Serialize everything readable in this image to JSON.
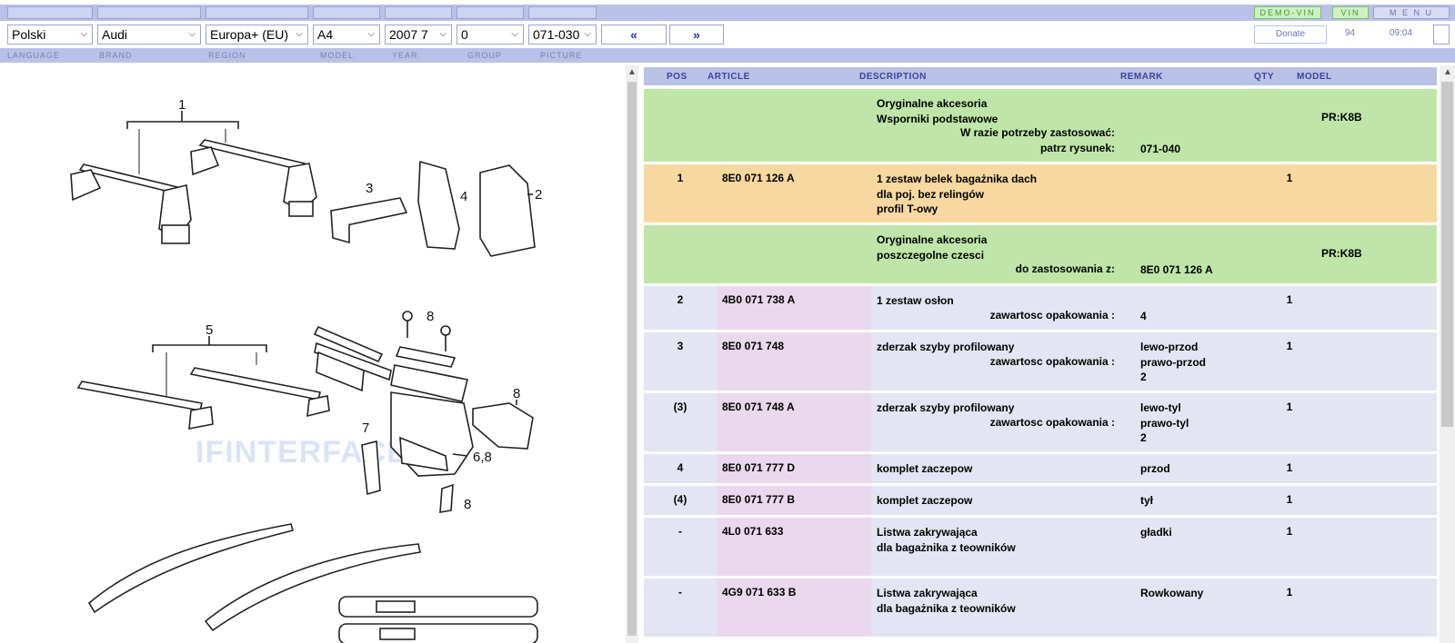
{
  "top_buttons": {
    "demo_vin": "DEMO-VIN",
    "vin": "VIN",
    "menu": "M E N U"
  },
  "selectors": {
    "language": "Polski",
    "brand": "Audi",
    "region": "Europa+ (EU)",
    "model": "A4",
    "year": "2007  7",
    "group": "0",
    "picture": "071-030"
  },
  "nav": {
    "prev": "«",
    "next": "»"
  },
  "status": {
    "donate": "Donate",
    "count": "94",
    "time": "09:04"
  },
  "labels": {
    "language": "LANGUAGE",
    "brand": "BRAND",
    "region": "REGION",
    "model": "MODEL",
    "year": "YEAR",
    "group": "GROUP",
    "picture": "PICTURE"
  },
  "picture": {
    "watermark": "IFINTERFACE",
    "callouts": [
      "1",
      "2",
      "3",
      "4",
      "5",
      "6,8",
      "7",
      "8",
      "8",
      "8"
    ]
  },
  "table": {
    "headers": {
      "pos": "POS",
      "article": "ARTICLE",
      "description": "DESCRIPTION",
      "remark": "REMARK",
      "qty": "QTY",
      "model": "MODEL"
    },
    "rows": [
      {
        "pos": "",
        "article": "",
        "desc": [
          "Oryginalne akcesoria",
          "Wsporniki podstawowe"
        ],
        "rtext": [
          "W razie potrzeby zastosować:",
          "patrz rysunek:"
        ],
        "remark": [
          "",
          "",
          "",
          "071-040"
        ],
        "qty": "",
        "model": "PR:K8B",
        "type": "green"
      },
      {
        "pos": "1",
        "article": "8E0 071 126 A",
        "desc": [
          "1 zestaw belek bagażnika dach",
          "dla poj. bez relingów",
          "profil T-owy"
        ],
        "rtext": [],
        "remark": [],
        "qty": "1",
        "model": "",
        "type": "orange"
      },
      {
        "pos": "",
        "article": "",
        "desc": [
          "Oryginalne akcesoria",
          "poszczegolne czesci"
        ],
        "rtext": [
          "do zastosowania z:"
        ],
        "remark": [
          "",
          "",
          "8E0 071 126 A"
        ],
        "qty": "",
        "model": "PR:K8B",
        "type": "green"
      },
      {
        "pos": "2",
        "article": "4B0 071 738 A",
        "desc": [
          "1 zestaw osłon"
        ],
        "rtext": [
          "zawartosc opakowania :"
        ],
        "remark": [
          "",
          "4"
        ],
        "qty": "1",
        "model": "",
        "type": "blue"
      },
      {
        "pos": "3",
        "article": "8E0 071 748",
        "desc": [
          "zderzak szyby profilowany"
        ],
        "rtext": [
          "zawartosc opakowania :"
        ],
        "remark": [
          "lewo-przod",
          "prawo-przod",
          "2"
        ],
        "qty": "1",
        "model": "",
        "type": "blue"
      },
      {
        "pos": "(3)",
        "article": "8E0 071 748 A",
        "desc": [
          "zderzak szyby profilowany"
        ],
        "rtext": [
          "zawartosc opakowania :"
        ],
        "remark": [
          "lewo-tyl",
          "prawo-tyl",
          "2"
        ],
        "qty": "1",
        "model": "",
        "type": "blue"
      },
      {
        "pos": "4",
        "article": "8E0 071 777 D",
        "desc": [
          "komplet zaczepow"
        ],
        "rtext": [],
        "remark": [
          "przod"
        ],
        "qty": "1",
        "model": "",
        "type": "blue"
      },
      {
        "pos": "(4)",
        "article": "8E0 071 777 B",
        "desc": [
          "komplet zaczepow"
        ],
        "rtext": [],
        "remark": [
          "tył"
        ],
        "qty": "1",
        "model": "",
        "type": "blue"
      },
      {
        "pos": "-",
        "article": "4L0 071 633",
        "desc": [
          "Listwa zakrywająca",
          "dla bagażnika z teowników"
        ],
        "rtext": [],
        "remark": [
          "gładki"
        ],
        "qty": "1",
        "model": "",
        "type": "blue"
      },
      {
        "pos": "-",
        "article": "4G9 071 633 B",
        "desc": [
          "Listwa zakrywająca",
          "dla bagażnika z teowników"
        ],
        "rtext": [],
        "remark": [
          "Rowkowany"
        ],
        "qty": "1",
        "model": "",
        "type": "blue"
      }
    ]
  },
  "colors": {
    "green": "#bfe6a8",
    "orange": "#f7d8a0",
    "blue": "#e3e6f2",
    "article_bg": "#ead8ec",
    "header": "#b9c1e6"
  }
}
